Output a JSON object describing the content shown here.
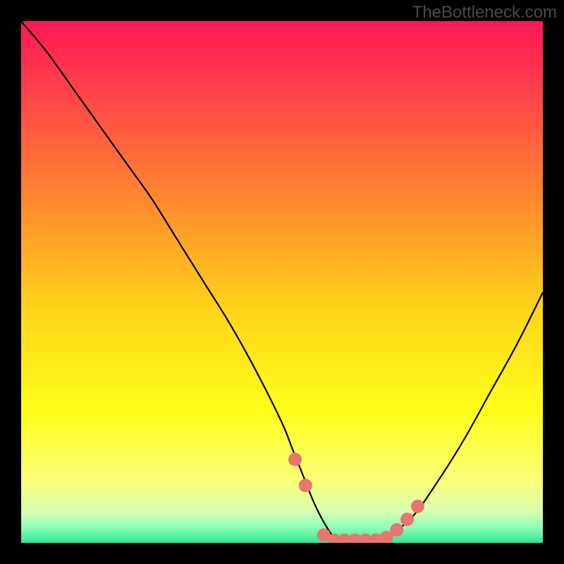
{
  "watermark": "TheBottleneck.com",
  "chart_data": {
    "type": "line",
    "title": "",
    "xlabel": "",
    "ylabel": "",
    "xlim": [
      0,
      100
    ],
    "ylim": [
      0,
      100
    ],
    "series": [
      {
        "name": "bottleneck-curve",
        "x": [
          0,
          5,
          10,
          15,
          20,
          25,
          30,
          35,
          40,
          45,
          50,
          52,
          54,
          56,
          58,
          60,
          62,
          64,
          66,
          68,
          70,
          75,
          80,
          85,
          90,
          95,
          100
        ],
        "y": [
          100,
          94,
          87,
          80,
          73,
          66,
          58,
          50,
          42,
          33,
          23,
          18,
          13,
          8,
          4,
          1,
          0,
          0,
          0,
          0,
          1,
          5,
          12,
          20,
          29,
          38,
          48
        ]
      }
    ],
    "markers": {
      "name": "highlight-points",
      "color": "#e8766c",
      "points": [
        {
          "x": 52.5,
          "y": 16
        },
        {
          "x": 54.5,
          "y": 11
        },
        {
          "x": 58,
          "y": 1.5
        },
        {
          "x": 60,
          "y": 0.5
        },
        {
          "x": 62,
          "y": 0.5
        },
        {
          "x": 64,
          "y": 0.5
        },
        {
          "x": 66,
          "y": 0.5
        },
        {
          "x": 68,
          "y": 0.5
        },
        {
          "x": 70,
          "y": 1
        },
        {
          "x": 72,
          "y": 2.5
        },
        {
          "x": 74,
          "y": 4.5
        },
        {
          "x": 76,
          "y": 7
        }
      ]
    },
    "background_gradient": {
      "stops": [
        {
          "pos": 0,
          "color": "#ff1856"
        },
        {
          "pos": 0.15,
          "color": "#ff4748"
        },
        {
          "pos": 0.35,
          "color": "#ff8b2e"
        },
        {
          "pos": 0.55,
          "color": "#ffd31a"
        },
        {
          "pos": 0.75,
          "color": "#ffff1a"
        },
        {
          "pos": 0.88,
          "color": "#fbff7a"
        },
        {
          "pos": 0.94,
          "color": "#d8ffb0"
        },
        {
          "pos": 0.97,
          "color": "#8effb8"
        },
        {
          "pos": 1.0,
          "color": "#2fe890"
        }
      ]
    }
  }
}
